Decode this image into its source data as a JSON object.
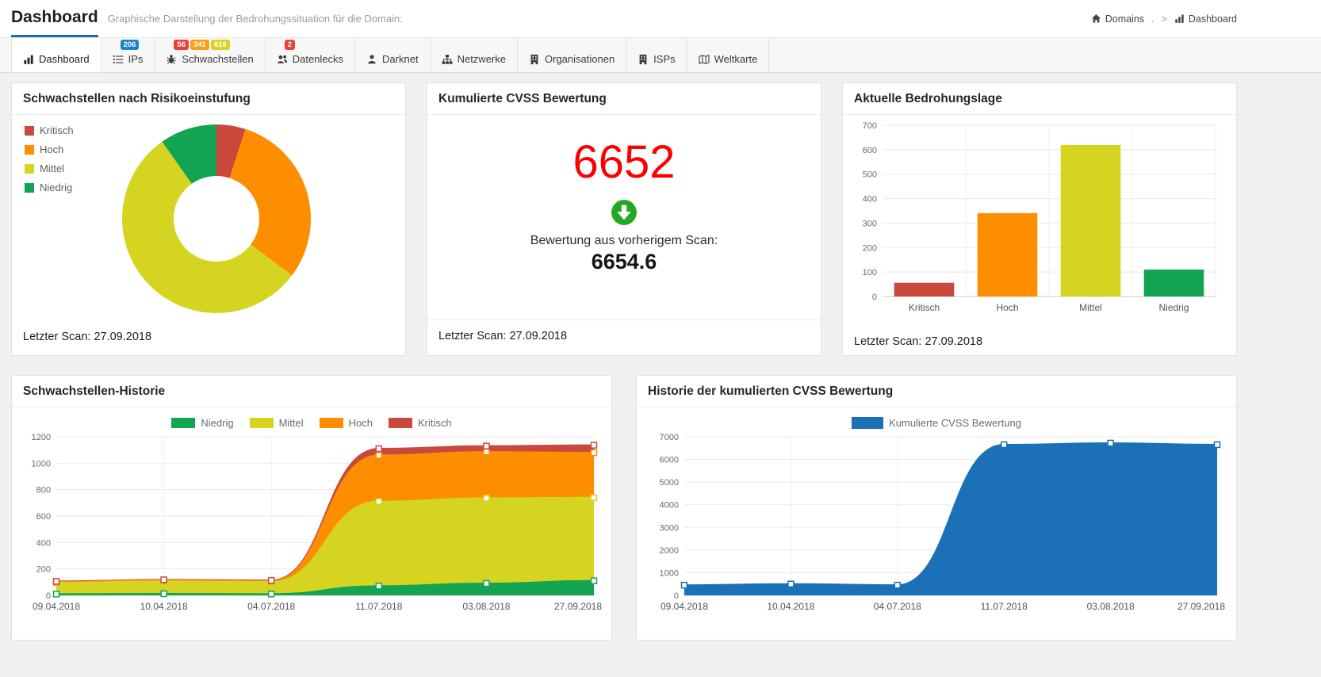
{
  "header": {
    "title": "Dashboard",
    "subtitle": "Graphische Darstellung der Bedrohungssituation für die Domain:",
    "breadcrumb": {
      "home": "Domains",
      "dot": ".",
      "separator": ">",
      "current": "Dashboard"
    }
  },
  "tabs": [
    {
      "id": "dashboard",
      "label": "Dashboard",
      "icon": "chart-bar",
      "active": true,
      "badges": []
    },
    {
      "id": "ips",
      "label": "IPs",
      "icon": "list",
      "active": false,
      "badges": [
        {
          "text": "206",
          "color": "#1b84c6"
        }
      ]
    },
    {
      "id": "schwachstellen",
      "label": "Schwachstellen",
      "icon": "bug",
      "active": false,
      "badges": [
        {
          "text": "56",
          "color": "#e8413c"
        },
        {
          "text": "341",
          "color": "#f5a11b"
        },
        {
          "text": "619",
          "color": "#d5d521"
        }
      ]
    },
    {
      "id": "datenlecks",
      "label": "Datenlecks",
      "icon": "users",
      "active": false,
      "badges": [
        {
          "text": "2",
          "color": "#e8413c"
        }
      ]
    },
    {
      "id": "darknet",
      "label": "Darknet",
      "icon": "user",
      "active": false,
      "badges": []
    },
    {
      "id": "netzwerke",
      "label": "Netzwerke",
      "icon": "sitemap",
      "active": false,
      "badges": []
    },
    {
      "id": "organisationen",
      "label": "Organisationen",
      "icon": "building",
      "active": false,
      "badges": []
    },
    {
      "id": "isps",
      "label": "ISPs",
      "icon": "building",
      "active": false,
      "badges": []
    },
    {
      "id": "weltkarte",
      "label": "Weltkarte",
      "icon": "map",
      "active": false,
      "badges": []
    }
  ],
  "cards": {
    "risk": {
      "title": "Schwachstellen nach Risikoeinstufung",
      "footer": "Letzter Scan: 27.09.2018"
    },
    "cvss": {
      "title": "Kumulierte CVSS Bewertung",
      "value": "6652",
      "trend_icon": "arrow-circle-down",
      "prev_label": "Bewertung aus vorherigem Scan:",
      "prev_value": "6654.6",
      "footer": "Letzter Scan: 27.09.2018"
    },
    "threat": {
      "title": "Aktuelle Bedrohungslage",
      "footer": "Letzter Scan: 27.09.2018"
    },
    "history": {
      "title": "Schwachstellen-Historie"
    },
    "cvss_history": {
      "title": "Historie der kumulierten CVSS Bewertung"
    }
  },
  "colors": {
    "kritisch": "#c9493c",
    "hoch": "#fd8e00",
    "mittel": "#d5d521",
    "niedrig": "#13a452",
    "cvss_blue": "#1c70b7",
    "big_number_red": "#fb0000",
    "trend_green": "#23a822",
    "accent_blue": "#1a6fad"
  },
  "chart_data": [
    {
      "type": "pie",
      "donut": true,
      "title": "Schwachstellen nach Risikoeinstufung",
      "labels": [
        "Kritisch",
        "Hoch",
        "Mittel",
        "Niedrig"
      ],
      "values": [
        56,
        341,
        619,
        110
      ],
      "colors": [
        "#c9493c",
        "#fd8e00",
        "#d5d521",
        "#13a452"
      ],
      "legend_position": "top-left"
    },
    {
      "type": "bar",
      "title": "Aktuelle Bedrohungslage",
      "categories": [
        "Kritisch",
        "Hoch",
        "Mittel",
        "Niedrig"
      ],
      "values": [
        56,
        341,
        619,
        110
      ],
      "colors": [
        "#c9493c",
        "#fd8e00",
        "#d5d521",
        "#13a452"
      ],
      "xlabel": "",
      "ylabel": "",
      "ylim": [
        0,
        700
      ],
      "ystep": 100,
      "grid": true,
      "legend_position": "none"
    },
    {
      "type": "area",
      "stacked": true,
      "title": "Schwachstellen-Historie",
      "x": [
        "09.04.2018",
        "10.04.2018",
        "04.07.2018",
        "11.07.2018",
        "03.08.2018",
        "27.09.2018"
      ],
      "series": [
        {
          "name": "Niedrig",
          "color": "#13a452",
          "values": [
            10,
            12,
            10,
            70,
            90,
            110
          ]
        },
        {
          "name": "Mittel",
          "color": "#d5d521",
          "values": [
            85,
            95,
            92,
            640,
            645,
            630
          ]
        },
        {
          "name": "Hoch",
          "color": "#fd8e00",
          "values": [
            6,
            6,
            6,
            350,
            350,
            340
          ]
        },
        {
          "name": "Kritisch",
          "color": "#c9493c",
          "values": [
            5,
            5,
            5,
            50,
            45,
            56
          ]
        }
      ],
      "ylim": [
        0,
        1200
      ],
      "ystep": 200,
      "grid": true,
      "legend_position": "top"
    },
    {
      "type": "area",
      "stacked": false,
      "title": "Historie der kumulierten CVSS Bewertung",
      "x": [
        "09.04.2018",
        "10.04.2018",
        "04.07.2018",
        "11.07.2018",
        "03.08.2018",
        "27.09.2018"
      ],
      "series": [
        {
          "name": "Kumulierte CVSS Bewertung",
          "color": "#1c70b7",
          "values": [
            450,
            500,
            450,
            6650,
            6720,
            6652
          ]
        }
      ],
      "ylim": [
        0,
        7000
      ],
      "ystep": 1000,
      "grid": true,
      "legend_position": "top"
    }
  ]
}
